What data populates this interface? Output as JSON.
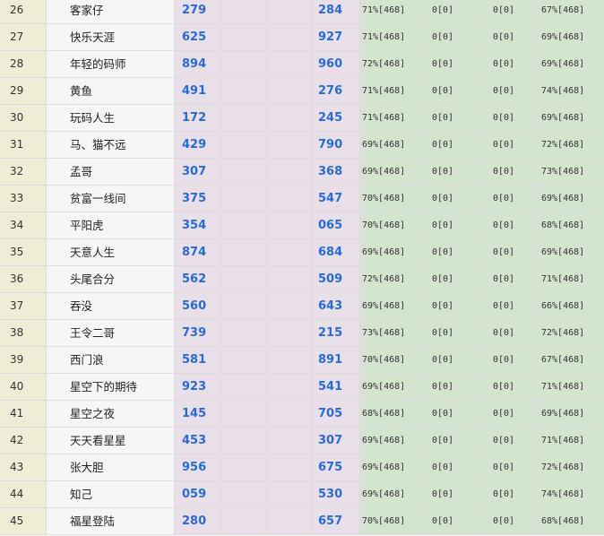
{
  "table": {
    "rows": [
      {
        "idx": "26",
        "name": "客家仔",
        "n1": "279",
        "n2": "284",
        "p1": "71%[468]",
        "p2": "0[0]",
        "p3": "0[0]",
        "p4": "67%[468]"
      },
      {
        "idx": "27",
        "name": "快乐天涯",
        "n1": "625",
        "n2": "927",
        "p1": "71%[468]",
        "p2": "0[0]",
        "p3": "0[0]",
        "p4": "69%[468]"
      },
      {
        "idx": "28",
        "name": "年轻的码师",
        "n1": "894",
        "n2": "960",
        "p1": "72%[468]",
        "p2": "0[0]",
        "p3": "0[0]",
        "p4": "69%[468]"
      },
      {
        "idx": "29",
        "name": "黄鱼",
        "n1": "491",
        "n2": "276",
        "p1": "71%[468]",
        "p2": "0[0]",
        "p3": "0[0]",
        "p4": "74%[468]"
      },
      {
        "idx": "30",
        "name": "玩码人生",
        "n1": "172",
        "n2": "245",
        "p1": "71%[468]",
        "p2": "0[0]",
        "p3": "0[0]",
        "p4": "69%[468]"
      },
      {
        "idx": "31",
        "name": "马、猫不远",
        "n1": "429",
        "n2": "790",
        "p1": "69%[468]",
        "p2": "0[0]",
        "p3": "0[0]",
        "p4": "72%[468]"
      },
      {
        "idx": "32",
        "name": "孟哥",
        "n1": "307",
        "n2": "368",
        "p1": "69%[468]",
        "p2": "0[0]",
        "p3": "0[0]",
        "p4": "73%[468]"
      },
      {
        "idx": "33",
        "name": "贫富一线间",
        "n1": "375",
        "n2": "547",
        "p1": "70%[468]",
        "p2": "0[0]",
        "p3": "0[0]",
        "p4": "69%[468]"
      },
      {
        "idx": "34",
        "name": "平阳虎",
        "n1": "354",
        "n2": "065",
        "p1": "70%[468]",
        "p2": "0[0]",
        "p3": "0[0]",
        "p4": "68%[468]"
      },
      {
        "idx": "35",
        "name": "天意人生",
        "n1": "874",
        "n2": "684",
        "p1": "69%[468]",
        "p2": "0[0]",
        "p3": "0[0]",
        "p4": "69%[468]"
      },
      {
        "idx": "36",
        "name": "头尾合分",
        "n1": "562",
        "n2": "509",
        "p1": "72%[468]",
        "p2": "0[0]",
        "p3": "0[0]",
        "p4": "71%[468]"
      },
      {
        "idx": "37",
        "name": "吞没",
        "n1": "560",
        "n2": "643",
        "p1": "69%[468]",
        "p2": "0[0]",
        "p3": "0[0]",
        "p4": "66%[468]"
      },
      {
        "idx": "38",
        "name": "王令二哥",
        "n1": "739",
        "n2": "215",
        "p1": "73%[468]",
        "p2": "0[0]",
        "p3": "0[0]",
        "p4": "72%[468]"
      },
      {
        "idx": "39",
        "name": "西门浪",
        "n1": "581",
        "n2": "891",
        "p1": "70%[468]",
        "p2": "0[0]",
        "p3": "0[0]",
        "p4": "67%[468]"
      },
      {
        "idx": "40",
        "name": "星空下的期待",
        "n1": "923",
        "n2": "541",
        "p1": "69%[468]",
        "p2": "0[0]",
        "p3": "0[0]",
        "p4": "71%[468]"
      },
      {
        "idx": "41",
        "name": "星空之夜",
        "n1": "145",
        "n2": "705",
        "p1": "68%[468]",
        "p2": "0[0]",
        "p3": "0[0]",
        "p4": "69%[468]"
      },
      {
        "idx": "42",
        "name": "天天看星星",
        "n1": "453",
        "n2": "307",
        "p1": "69%[468]",
        "p2": "0[0]",
        "p3": "0[0]",
        "p4": "71%[468]"
      },
      {
        "idx": "43",
        "name": "张大胆",
        "n1": "956",
        "n2": "675",
        "p1": "69%[468]",
        "p2": "0[0]",
        "p3": "0[0]",
        "p4": "72%[468]"
      },
      {
        "idx": "44",
        "name": "知己",
        "n1": "059",
        "n2": "530",
        "p1": "69%[468]",
        "p2": "0[0]",
        "p3": "0[0]",
        "p4": "74%[468]"
      },
      {
        "idx": "45",
        "name": "福星登陆",
        "n1": "280",
        "n2": "657",
        "p1": "70%[468]",
        "p2": "0[0]",
        "p3": "0[0]",
        "p4": "68%[468]"
      }
    ]
  },
  "colors": {
    "index_bg": "#eeeed6",
    "name_bg": "#f6f6f6",
    "number_bg": "#e8dfe9",
    "percent_bg": "#d3e4cf",
    "number_text": "#2a6ad8",
    "grid_line": "#dcdcdc"
  }
}
